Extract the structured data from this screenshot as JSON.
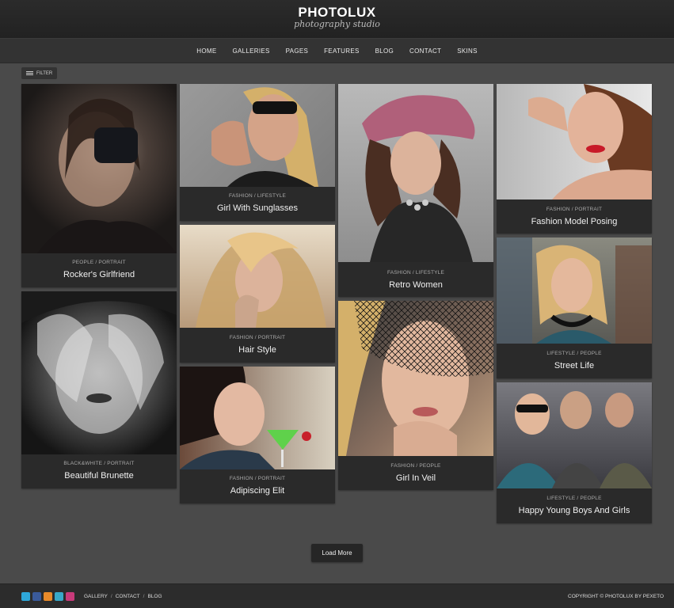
{
  "header": {
    "logo": "PHOTOLUX",
    "tagline": "photography studio"
  },
  "nav": {
    "items": [
      "HOME",
      "GALLERIES",
      "PAGES",
      "FEATURES",
      "BLOG",
      "CONTACT",
      "SKINS"
    ]
  },
  "filter": {
    "label": "FILTER"
  },
  "gallery": [
    {
      "category": "PEOPLE / PORTRAIT",
      "title": "Rocker's Girlfriend"
    },
    {
      "category": "BLACK&WHITE / PORTRAIT",
      "title": "Beautiful Brunette"
    },
    {
      "category": "FASHION / LIFESTYLE",
      "title": "Girl With Sunglasses"
    },
    {
      "category": "FASHION / PORTRAIT",
      "title": "Hair Style"
    },
    {
      "category": "FASHION / PORTRAIT",
      "title": "Adipiscing Elit"
    },
    {
      "category": "FASHION / LIFESTYLE",
      "title": "Retro Women"
    },
    {
      "category": "FASHION / PEOPLE",
      "title": "Girl In Veil"
    },
    {
      "category": "FASHION / PORTRAIT",
      "title": "Fashion Model Posing"
    },
    {
      "category": "LIFESTYLE / PEOPLE",
      "title": "Street Life"
    },
    {
      "category": "LIFESTYLE / PEOPLE",
      "title": "Happy Young Boys And Girls"
    }
  ],
  "load_more": {
    "label": "Load More"
  },
  "footer": {
    "links": [
      "GALLERY",
      "CONTACT",
      "BLOG"
    ],
    "copyright": "COPYRIGHT © PHOTOLUX BY PEXETO",
    "social_icons": [
      "twitter-icon",
      "facebook-icon",
      "rss-icon",
      "vimeo-icon",
      "instagram-icon"
    ]
  },
  "colors": {
    "background": "#4a4a4a",
    "card": "#2a2a2a",
    "header": "#262626",
    "nav": "#333333"
  }
}
